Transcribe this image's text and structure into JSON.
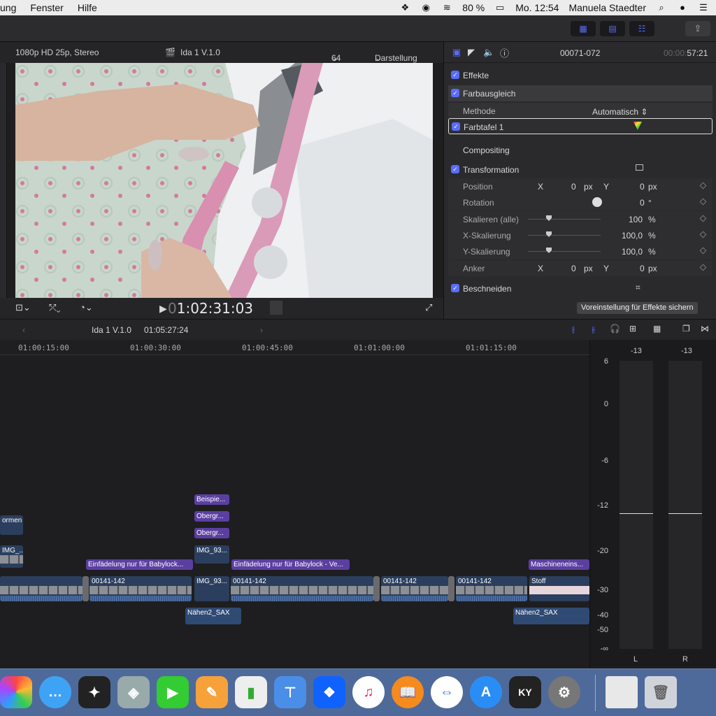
{
  "menubar": {
    "items": [
      "ung",
      "Fenster",
      "Hilfe"
    ],
    "battery": "80 %",
    "clock": "Mo. 12:54",
    "user": "Manuela Staedter"
  },
  "viewer": {
    "format": "1080p HD 25p, Stereo",
    "project": "Ida 1 V.1.0",
    "zoom": "64 %",
    "display_menu": "Darstellung",
    "timecode_dim": "0",
    "timecode": "1:02:31:03"
  },
  "inspector": {
    "clip_name": "00071-072",
    "duration_dim": "00:00:",
    "duration": "57:21",
    "effects_label": "Effekte",
    "color_correction": "Farbausgleich",
    "method_label": "Methode",
    "method_value": "Automatisch",
    "color_board": "Farbtafel 1",
    "compositing": "Compositing",
    "transformation": "Transformation",
    "rows": [
      {
        "label": "Position",
        "x_label": "X",
        "x": "0",
        "x_unit": "px",
        "y_label": "Y",
        "y": "0",
        "y_unit": "px"
      },
      {
        "label": "Rotation",
        "value": "0",
        "unit": "°"
      },
      {
        "label": "Skalieren (alle)",
        "value": "100",
        "unit": "%"
      },
      {
        "label": "X-Skalierung",
        "value": "100,0",
        "unit": "%"
      },
      {
        "label": "Y-Skalierung",
        "value": "100,0",
        "unit": "%"
      },
      {
        "label": "Anker",
        "x_label": "X",
        "x": "0",
        "x_unit": "px",
        "y_label": "Y",
        "y": "0",
        "y_unit": "px"
      }
    ],
    "crop": "Beschneiden",
    "save_button": "Voreinstellung für Effekte sichern"
  },
  "timeline": {
    "project": "Ida 1 V.1.0",
    "position": "01:05:27:24",
    "ruler": [
      "01:00:15:00",
      "01:00:30:00",
      "01:00:45:00",
      "01:01:00:00",
      "01:01:15:00"
    ],
    "titles": [
      "Beispie...",
      "Obergr...",
      "Obergr..."
    ],
    "connected": [
      "ormen",
      "IMG_...",
      "IMG_93..."
    ],
    "captions": [
      "Einfädelung nur für Babylock...",
      "Einfädelung nur für Babylock - Ve...",
      "Maschineneins..."
    ],
    "primary": [
      "00141-142",
      "IMG_93...",
      "00141-142",
      "00141-142",
      "00141-142",
      "Stoff"
    ],
    "audio": [
      "Nähen2_SAX",
      "Nähen2_SAX"
    ]
  },
  "meters": {
    "peak_left": "-13",
    "peak_right": "-13",
    "scale": [
      "6",
      "0",
      "-6",
      "-12",
      "-20",
      "-30",
      "-40",
      "-50",
      "-∞"
    ],
    "left": "L",
    "right": "R"
  },
  "dock": {
    "icons": [
      "photos-icon",
      "messages-icon",
      "final-cut-icon",
      "preview-icon",
      "facetime-icon",
      "pages-icon",
      "numbers-icon",
      "keynote-icon",
      "dropbox-icon",
      "itunes-icon",
      "ibooks-icon",
      "teamviewer-icon",
      "app-store-icon",
      "kyno-icon",
      "system-preferences-icon",
      "desktop-icon",
      "trash-icon"
    ]
  }
}
